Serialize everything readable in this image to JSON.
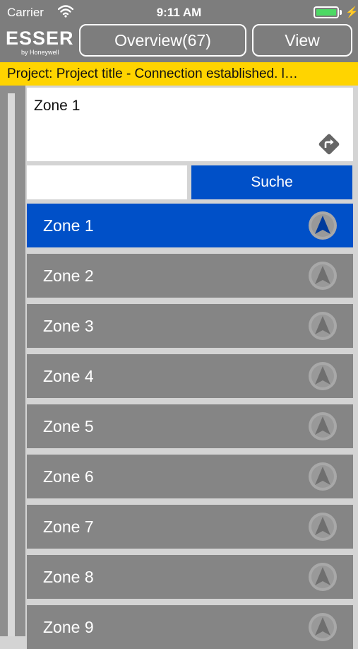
{
  "status_bar": {
    "carrier": "Carrier",
    "time": "9:11 AM"
  },
  "header": {
    "logo_brand": "ESSER",
    "logo_sub": "by Honeywell",
    "overview_label": "Overview(67)",
    "view_label": "View"
  },
  "banner": {
    "text": "Project:  Project title  -  Connection established. l…"
  },
  "zone_card": {
    "title": "Zone 1"
  },
  "search": {
    "value": "",
    "placeholder": "",
    "button_label": "Suche"
  },
  "zones": [
    {
      "label": "Zone 1",
      "selected": true
    },
    {
      "label": "Zone 2",
      "selected": false
    },
    {
      "label": "Zone 3",
      "selected": false
    },
    {
      "label": "Zone 4",
      "selected": false
    },
    {
      "label": "Zone 5",
      "selected": false
    },
    {
      "label": "Zone 6",
      "selected": false
    },
    {
      "label": "Zone 7",
      "selected": false
    },
    {
      "label": "Zone 8",
      "selected": false
    },
    {
      "label": "Zone 9",
      "selected": false
    }
  ],
  "icons": {
    "wifi": "wifi-icon",
    "battery": "battery-icon",
    "charging": "charging-bolt-icon",
    "direction": "direction-arrow-icon",
    "navigate": "navigate-arrow-icon"
  },
  "colors": {
    "accent": "#0050c8",
    "banner": "#ffd400",
    "bar": "#7d7d7d",
    "battery": "#4cd964"
  }
}
